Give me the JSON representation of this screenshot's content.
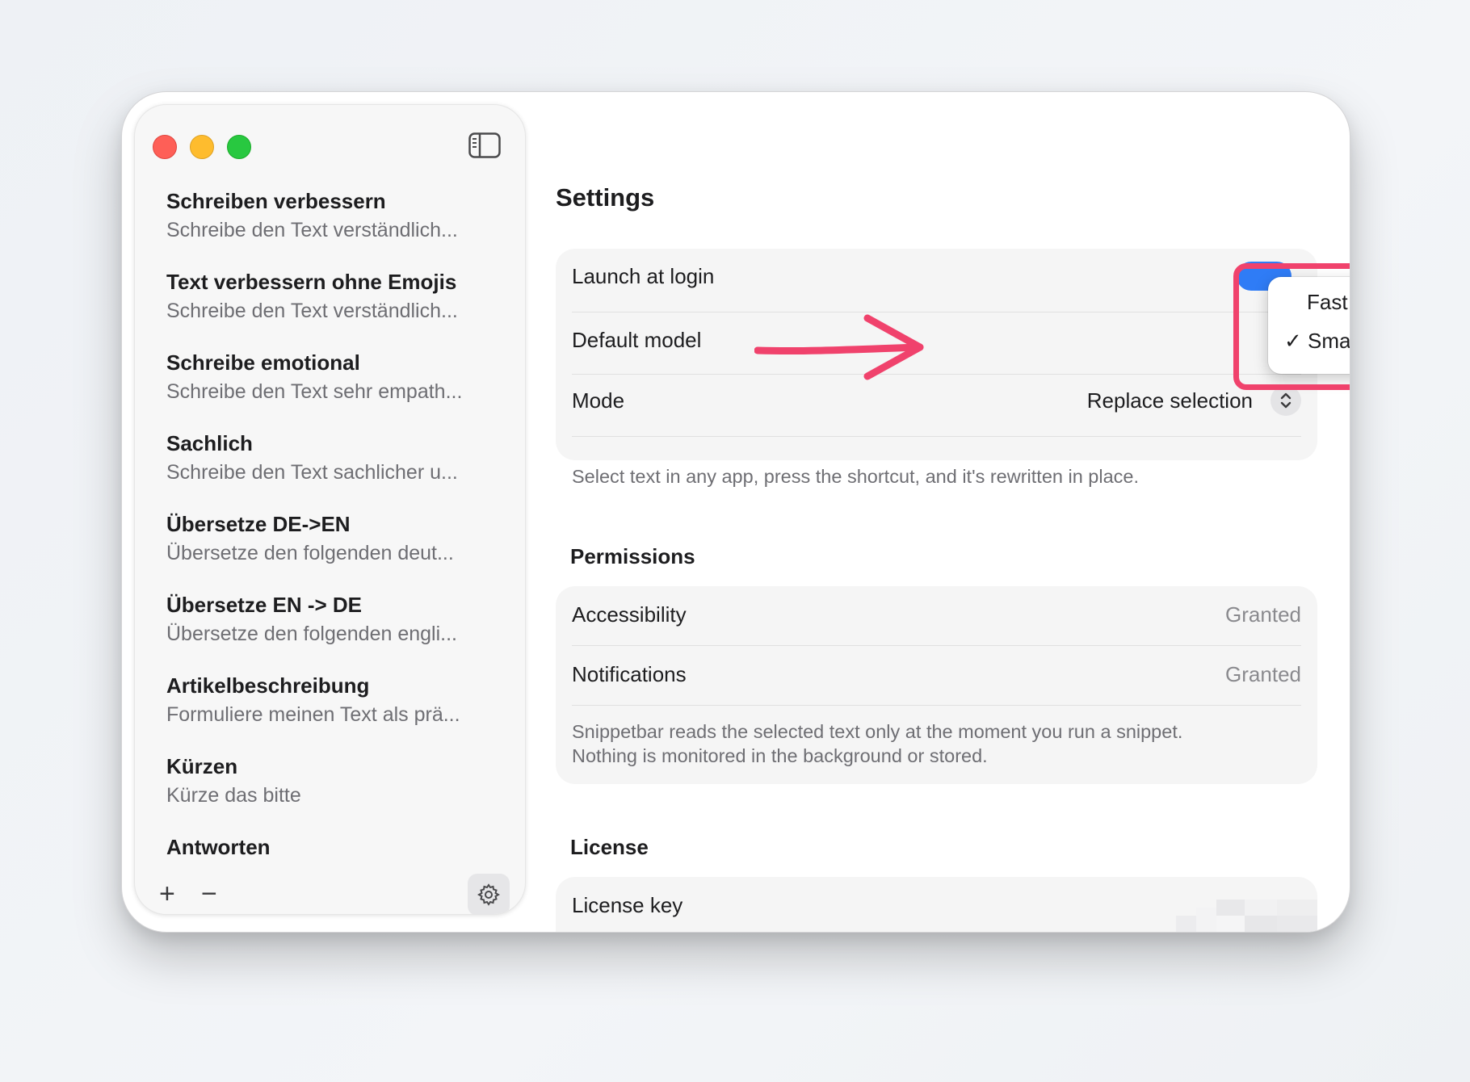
{
  "sidebar": {
    "snippets": [
      {
        "title": "Schreiben verbessern",
        "subtitle": "Schreibe den Text verständlich..."
      },
      {
        "title": "Text verbessern ohne Emojis",
        "subtitle": "Schreibe den Text verständlich..."
      },
      {
        "title": "Schreibe emotional",
        "subtitle": "Schreibe den Text sehr empath..."
      },
      {
        "title": "Sachlich",
        "subtitle": "Schreibe den Text sachlicher u..."
      },
      {
        "title": "Übersetze DE->EN",
        "subtitle": "Übersetze den folgenden deut..."
      },
      {
        "title": "Übersetze EN -> DE",
        "subtitle": "Übersetze den folgenden engli..."
      },
      {
        "title": "Artikelbeschreibung",
        "subtitle": "Formuliere meinen Text als prä..."
      },
      {
        "title": "Kürzen",
        "subtitle": "Kürze das bitte"
      },
      {
        "title": "Antworten",
        "subtitle": ""
      }
    ],
    "add_label": "+",
    "remove_label": "−"
  },
  "settings": {
    "title": "Settings",
    "launch_at_login_label": "Launch at login",
    "launch_at_login_on": true,
    "default_model_label": "Default model",
    "mode_label": "Mode",
    "mode_value": "Replace selection",
    "general_note": "Select text in any app, press the shortcut, and it's rewritten in place."
  },
  "model_menu": {
    "options": [
      "Fast",
      "Smart"
    ],
    "selected": "Smart",
    "check": "✓"
  },
  "permissions": {
    "title": "Permissions",
    "accessibility_label": "Accessibility",
    "accessibility_value": "Granted",
    "notifications_label": "Notifications",
    "notifications_value": "Granted",
    "note_line1": "Snippetbar reads the selected text only at the moment you run a snippet.",
    "note_line2": "Nothing is monitored in the background or stored."
  },
  "license": {
    "title": "License",
    "key_label": "License key"
  },
  "colors": {
    "annotation": "#f0426c",
    "accent": "#2f7cf6"
  }
}
